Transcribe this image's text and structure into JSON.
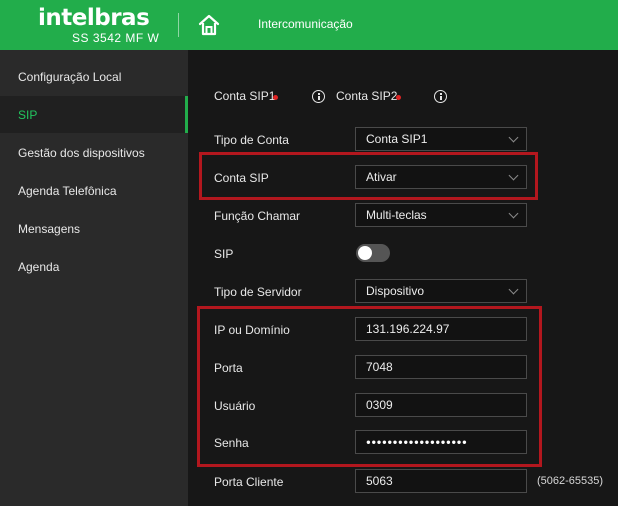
{
  "header": {
    "brand": "intelbras",
    "model": "SS 3542 MF W",
    "title": "Intercomunicação",
    "colors": {
      "bar": "#22ad4b"
    }
  },
  "sidebar": {
    "items": [
      {
        "label": "Configuração Local",
        "active": false
      },
      {
        "label": "SIP",
        "active": true
      },
      {
        "label": "Gestão dos dispositivos",
        "active": false
      },
      {
        "label": "Agenda Telefônica",
        "active": false
      },
      {
        "label": "Mensagens",
        "active": false
      },
      {
        "label": "Agenda",
        "active": false
      }
    ]
  },
  "tabs": [
    {
      "label": "Conta SIP1",
      "status_color": "#e02424"
    },
    {
      "label": "Conta SIP2",
      "status_color": "#e02424"
    }
  ],
  "form": {
    "tipo_conta": {
      "label": "Tipo de Conta",
      "value": "Conta SIP1"
    },
    "conta_sip": {
      "label": "Conta SIP",
      "value": "Ativar"
    },
    "funcao_chamar": {
      "label": "Função Chamar",
      "value": "Multi-teclas"
    },
    "sip": {
      "label": "SIP",
      "enabled": false
    },
    "tipo_servidor": {
      "label": "Tipo de Servidor",
      "value": "Dispositivo"
    },
    "ip_dominio": {
      "label": "IP ou Domínio",
      "value": "131.196.224.97"
    },
    "porta": {
      "label": "Porta",
      "value": "7048"
    },
    "usuario": {
      "label": "Usuário",
      "value": "0309"
    },
    "senha": {
      "label": "Senha",
      "value": "●●●●●●●●●●●●●●●●●●●"
    },
    "porta_cliente": {
      "label": "Porta Cliente",
      "value": "5063",
      "range": "(5062-65535)"
    }
  },
  "highlight_color": "#b3171e"
}
